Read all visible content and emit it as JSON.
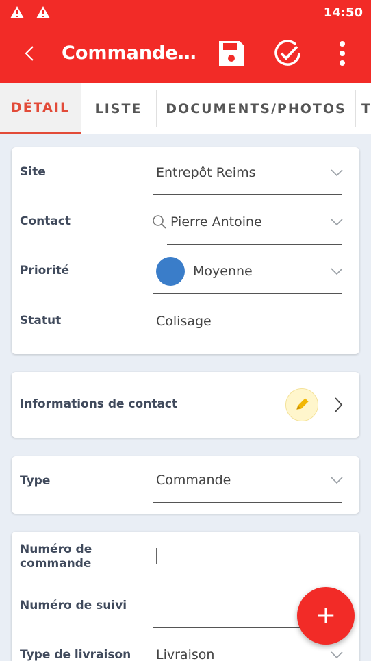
{
  "status_bar": {
    "time": "14:50",
    "icons": [
      "warning-icon",
      "warning-icon"
    ]
  },
  "app_bar": {
    "title": "Commande c...",
    "actions": [
      "save-icon",
      "check-circle-icon",
      "more-vert-icon"
    ]
  },
  "tabs": [
    {
      "label": "DÉTAIL",
      "active": true
    },
    {
      "label": "LISTE",
      "active": false
    },
    {
      "label": "DOCUMENTS/PHOTOS",
      "active": false
    },
    {
      "label": "T",
      "active": false
    }
  ],
  "main_card": {
    "site": {
      "label": "Site",
      "value": "Entrepôt Reims"
    },
    "contact": {
      "label": "Contact",
      "value": "Pierre Antoine"
    },
    "priorite": {
      "label": "Priorité",
      "value": "Moyenne",
      "color": "#3a7dc9"
    },
    "statut": {
      "label": "Statut",
      "value": "Colisage"
    }
  },
  "contact_card": {
    "label": "Informations de contact"
  },
  "type_card": {
    "label": "Type",
    "value": "Commande"
  },
  "order_card": {
    "numero_commande": {
      "label_line1": "Numéro de",
      "label_line2": "commande",
      "value": ""
    },
    "numero_suivi": {
      "label": "Numéro de suivi",
      "value": ""
    },
    "type_livraison": {
      "label": "Type de livraison",
      "value": "Livraison"
    }
  },
  "fab": {
    "label": "+"
  },
  "colors": {
    "primary": "#f22b27",
    "accent": "#e24b39",
    "priority_medium": "#3a7dc9",
    "edit_badge": "#fff6cc"
  }
}
